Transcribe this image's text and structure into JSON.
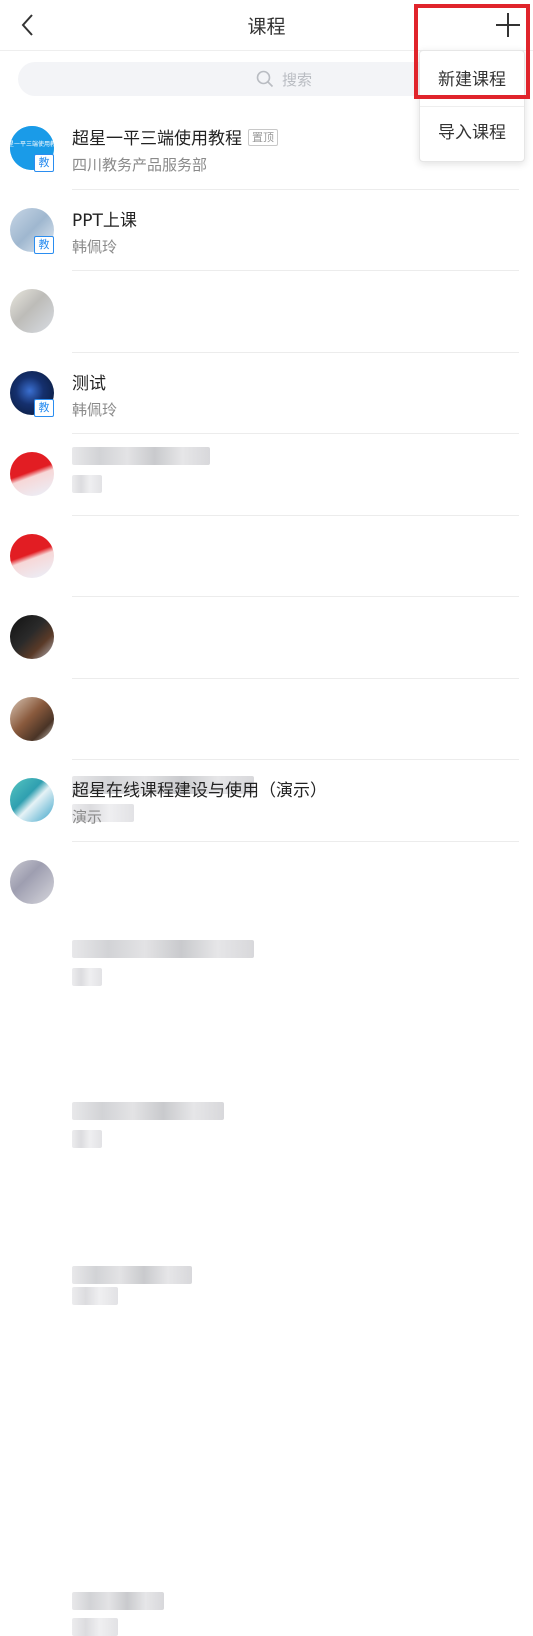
{
  "header": {
    "title": "课程"
  },
  "search": {
    "placeholder": "搜索"
  },
  "menu": {
    "items": [
      {
        "label": "新建课程"
      },
      {
        "label": "导入课程"
      }
    ]
  },
  "colors": {
    "accent_blue": "#2a8df0",
    "highlight_red": "#e0242b"
  },
  "courses": [
    {
      "name": "超星一平三端使用教程",
      "pin": "置顶",
      "teacher": "四川教务产品服务部",
      "badge": "教",
      "cover_text": "超星一平三端使用教程"
    },
    {
      "name": "PPT上课",
      "teacher": "韩佩玲",
      "badge": "教"
    },
    {
      "name": "",
      "teacher": ""
    },
    {
      "name": "测试",
      "teacher": "韩佩玲",
      "badge": "教"
    },
    {
      "name": "",
      "teacher": ""
    },
    {
      "name": "",
      "teacher": ""
    },
    {
      "name": "",
      "teacher": ""
    },
    {
      "name": "",
      "teacher": ""
    },
    {
      "name": "超星在线课程建设与使用（演示）",
      "teacher": "演示"
    },
    {
      "name": "",
      "teacher": ""
    }
  ]
}
